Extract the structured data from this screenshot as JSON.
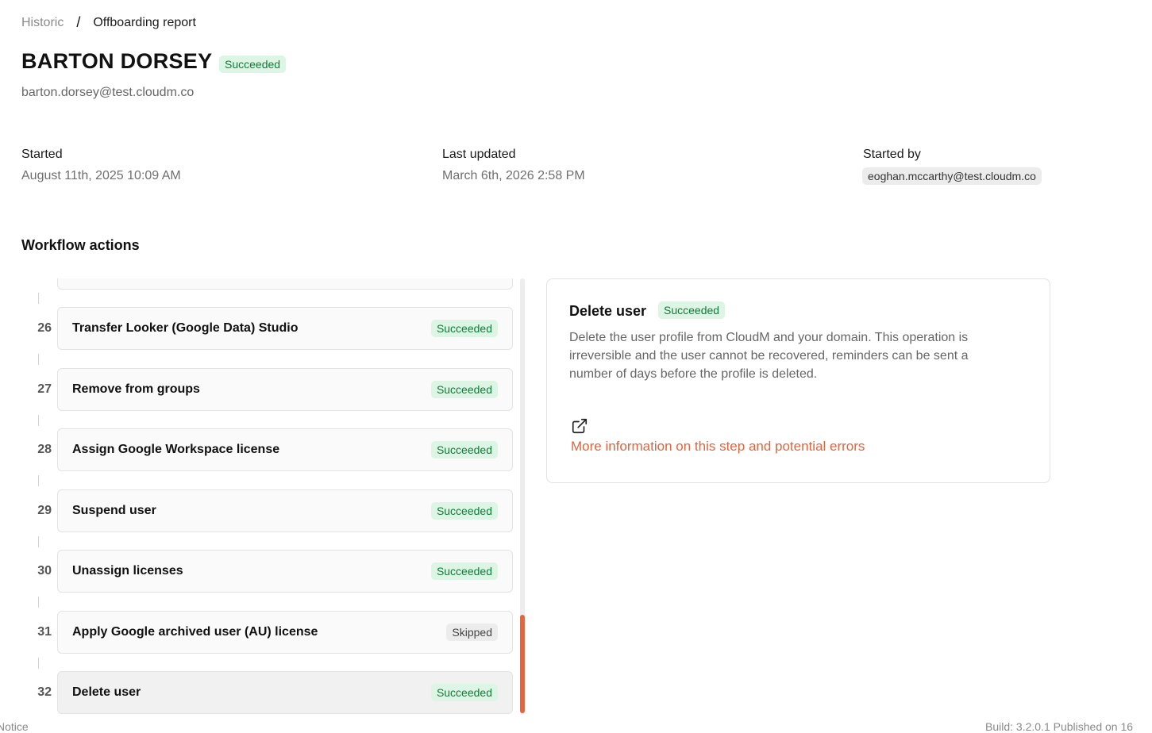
{
  "breadcrumb": {
    "parent": "Historic",
    "separator": "/",
    "current": "Offboarding report"
  },
  "header": {
    "name": "BARTON DORSEY",
    "status": "Succeeded",
    "email": "barton.dorsey@test.cloudm.co"
  },
  "meta": {
    "started_label": "Started",
    "started_value": "August 11th, 2025 10:09 AM",
    "updated_label": "Last updated",
    "updated_value": "March 6th, 2026 2:58 PM",
    "started_by_label": "Started by",
    "started_by_value": "eoghan.mccarthy@test.cloudm.co"
  },
  "workflow": {
    "title": "Workflow actions",
    "steps": [
      {
        "number": "26",
        "title": "Transfer Looker (Google Data) Studio",
        "status": "Succeeded"
      },
      {
        "number": "27",
        "title": "Remove from groups",
        "status": "Succeeded"
      },
      {
        "number": "28",
        "title": "Assign Google Workspace license",
        "status": "Succeeded"
      },
      {
        "number": "29",
        "title": "Suspend user",
        "status": "Succeeded"
      },
      {
        "number": "30",
        "title": "Unassign licenses",
        "status": "Succeeded"
      },
      {
        "number": "31",
        "title": "Apply Google archived user (AU) license",
        "status": "Skipped"
      },
      {
        "number": "32",
        "title": "Delete user",
        "status": "Succeeded"
      }
    ],
    "selected_step": "32"
  },
  "detail": {
    "title": "Delete user",
    "status": "Succeeded",
    "description": "Delete the user profile from CloudM and your domain. This operation is irreversible and the user cannot be recovered, reminders can be sent a number of days before the profile is deleted.",
    "link_icon": "external-link-icon",
    "link_text": "More information on this step and potential errors"
  },
  "footer": {
    "left_text": "Notice",
    "right_text": "Build: 3.2.0.1 Published on 16"
  },
  "colors": {
    "success_bg": "#dcf5e4",
    "success_text": "#127a3a",
    "skipped_bg": "#ececec",
    "accent": "#e8643c"
  }
}
